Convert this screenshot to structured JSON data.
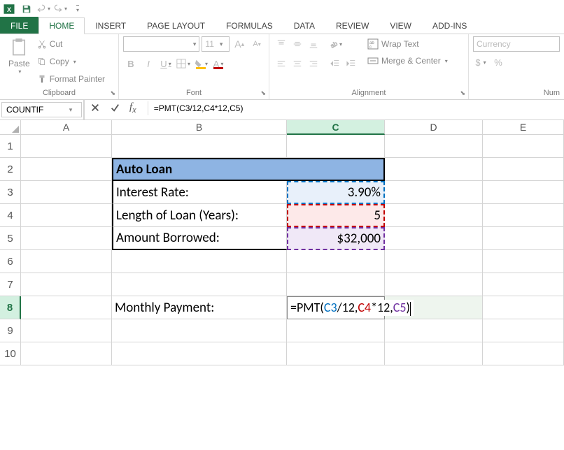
{
  "qat": {
    "save": "save-icon",
    "undo": "undo-icon",
    "redo": "redo-icon",
    "customize": "customize-icon"
  },
  "tabs": {
    "file": "FILE",
    "home": "HOME",
    "insert": "INSERT",
    "page_layout": "PAGE LAYOUT",
    "formulas": "FORMULAS",
    "data": "DATA",
    "review": "REVIEW",
    "view": "VIEW",
    "addins": "ADD-INS"
  },
  "ribbon": {
    "clipboard": {
      "paste": "Paste",
      "cut": "Cut",
      "copy": "Copy",
      "format_painter": "Format Painter",
      "label": "Clipboard"
    },
    "font": {
      "name_placeholder": "",
      "size": "11",
      "bold": "B",
      "italic": "I",
      "underline": "U",
      "label": "Font"
    },
    "alignment": {
      "wrap": "Wrap Text",
      "merge": "Merge & Center",
      "label": "Alignment"
    },
    "number": {
      "format": "Currency",
      "dollar": "$",
      "percent": "%",
      "label": "Num"
    }
  },
  "formula_bar": {
    "name_box": "COUNTIF",
    "formula": "=PMT(C3/12,C4*12,C5)"
  },
  "columns": [
    "A",
    "B",
    "C",
    "D",
    "E"
  ],
  "rows": [
    "1",
    "2",
    "3",
    "4",
    "5",
    "6",
    "7",
    "8",
    "9",
    "10"
  ],
  "active_col": "C",
  "active_row": "8",
  "cells": {
    "B2": "Auto Loan",
    "B3": "Interest Rate:",
    "C3": "3.90%",
    "B4": "Length of Loan (Years):",
    "C4": "5",
    "B5": "Amount Borrowed:",
    "C5": "$32,000",
    "B8": "Monthly Payment:",
    "C8_editing": {
      "prefix": "=PMT(",
      "r1": "C3",
      "m1": "/12,",
      "r2": "C4",
      "m2": "*12,",
      "r3": "C5",
      "suffix": ")"
    }
  }
}
